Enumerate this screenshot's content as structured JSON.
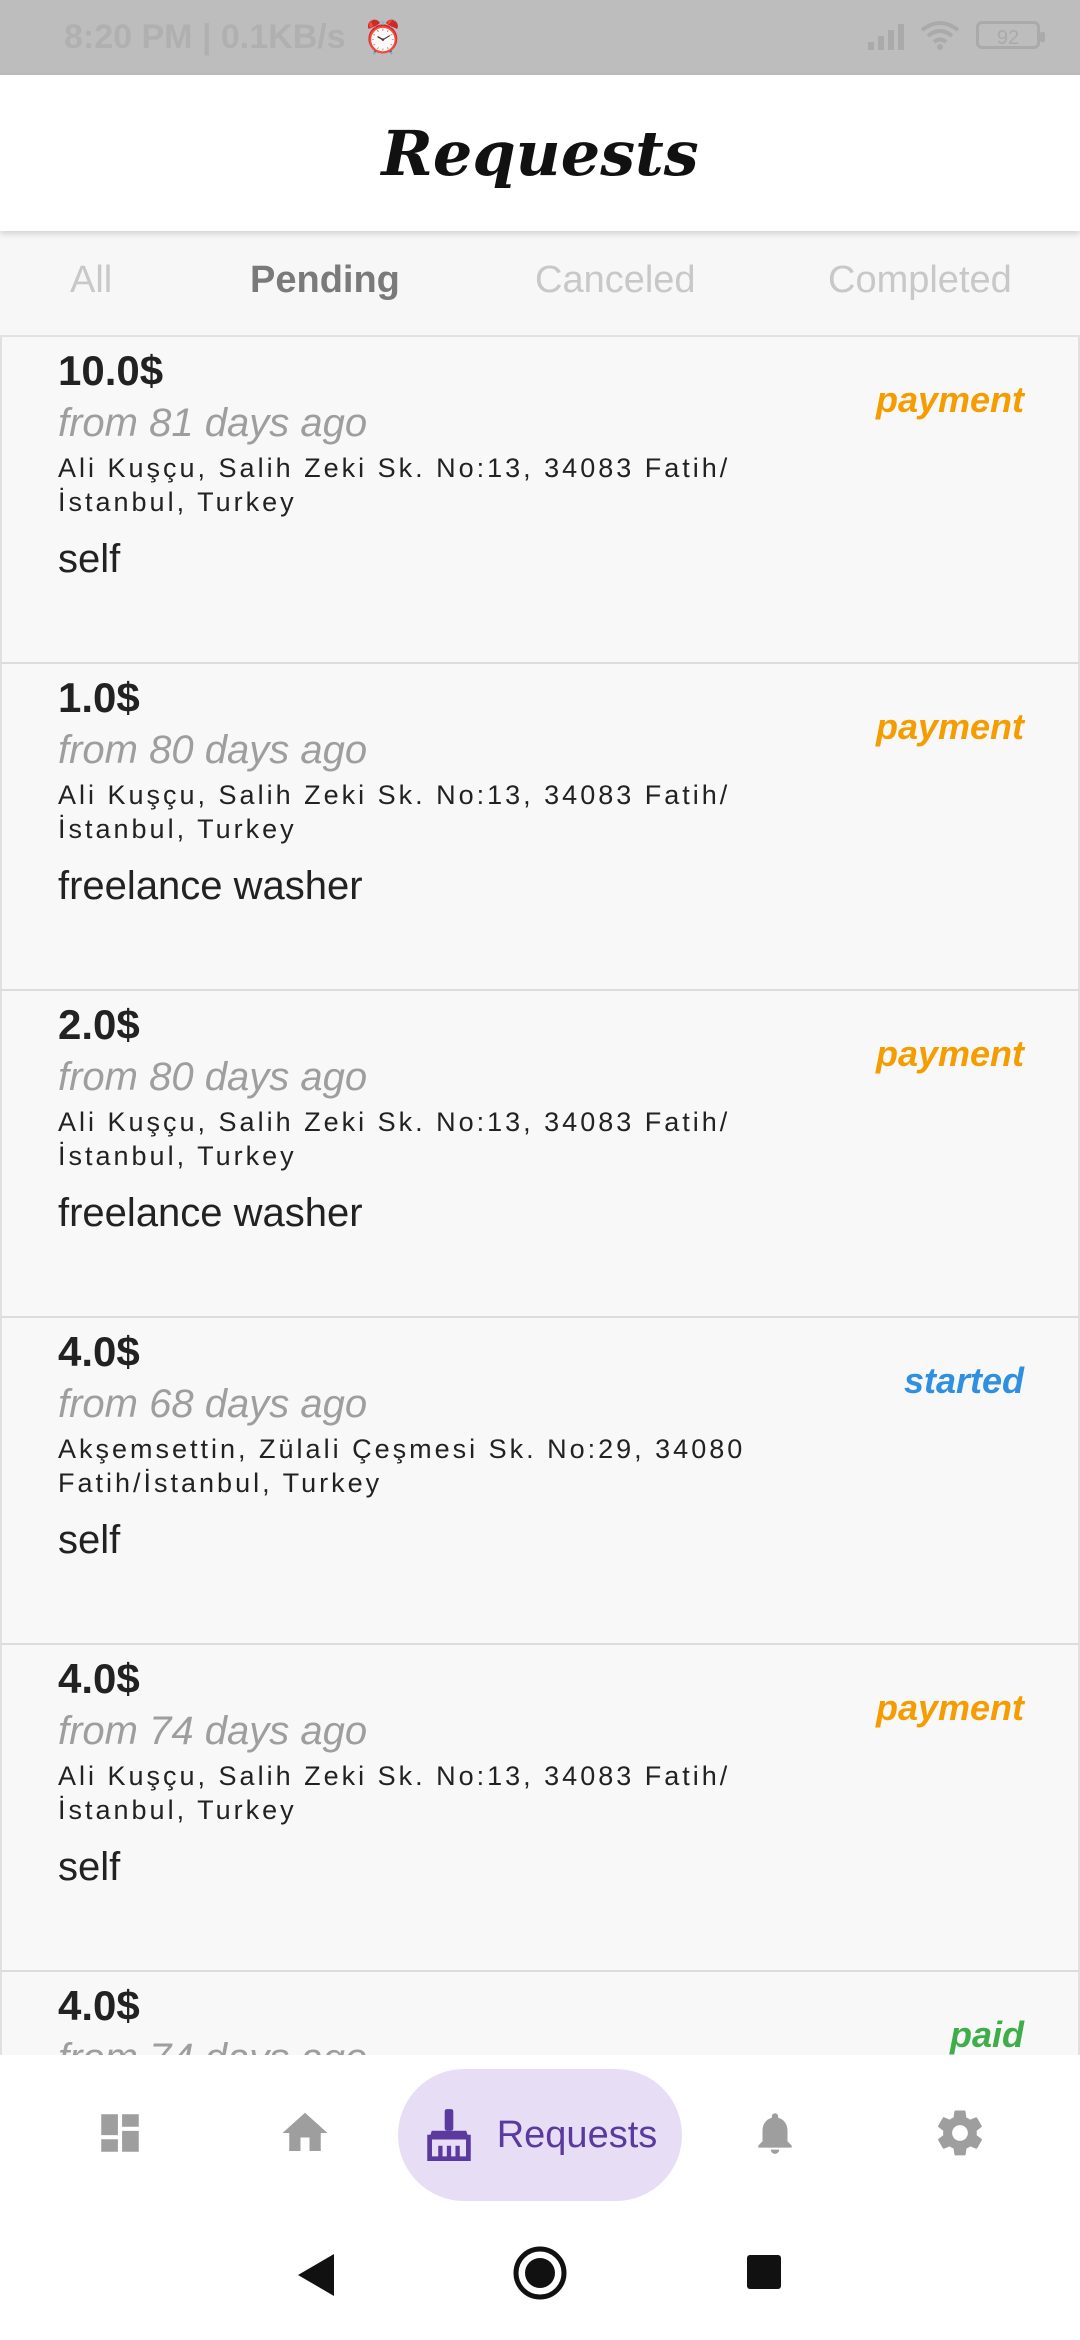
{
  "status_bar": {
    "time_speed": "8:20 PM | 0.1KB/s",
    "battery": "92"
  },
  "header": {
    "title": "Requests"
  },
  "tabs": [
    {
      "label": "All",
      "active": false
    },
    {
      "label": "Pending",
      "active": true
    },
    {
      "label": "Canceled",
      "active": false
    },
    {
      "label": "Completed",
      "active": false
    }
  ],
  "requests": [
    {
      "price": "10.0$",
      "ago": "from 81 days ago",
      "address": "Ali Kuşçu, Salih Zeki Sk. No:13, 34083 Fatih/İstanbul, Turkey",
      "description": "self",
      "status": "payment",
      "status_color": "#f59c00"
    },
    {
      "price": "1.0$",
      "ago": "from 80 days ago",
      "address": "Ali Kuşçu, Salih Zeki Sk. No:13, 34083 Fatih/İstanbul, Turkey",
      "description": "freelance washer",
      "status": "payment",
      "status_color": "#f59c00"
    },
    {
      "price": "2.0$",
      "ago": "from 80 days ago",
      "address": "Ali Kuşçu, Salih Zeki Sk. No:13, 34083 Fatih/İstanbul, Turkey",
      "description": "freelance washer",
      "status": "payment",
      "status_color": "#f59c00"
    },
    {
      "price": "4.0$",
      "ago": "from 68 days ago",
      "address": "Akşemsettin, Zülali Çeşmesi Sk. No:29, 34080 Fatih/İstanbul, Turkey",
      "description": "self",
      "status": "started",
      "status_color": "#2f8fe0"
    },
    {
      "price": "4.0$",
      "ago": "from 74 days ago",
      "address": "Ali Kuşçu, Salih Zeki Sk. No:13, 34083 Fatih/İstanbul, Turkey",
      "description": "self",
      "status": "payment",
      "status_color": "#f59c00"
    },
    {
      "price": "4.0$",
      "ago": "from 74 days ago",
      "address": "",
      "description": "",
      "status": "paid",
      "status_color": "#3fae49"
    }
  ],
  "bottom_nav": {
    "items": [
      {
        "icon": "dashboard-icon"
      },
      {
        "icon": "home-icon"
      },
      {
        "icon": "broom-icon",
        "label": "Requests",
        "active": true
      },
      {
        "icon": "bell-icon"
      },
      {
        "icon": "gear-icon"
      }
    ]
  },
  "colors": {
    "accent": "#5b3aa0",
    "accent_bg": "#e7def5",
    "payment": "#f59c00",
    "started": "#2f8fe0",
    "paid": "#3fae49"
  }
}
